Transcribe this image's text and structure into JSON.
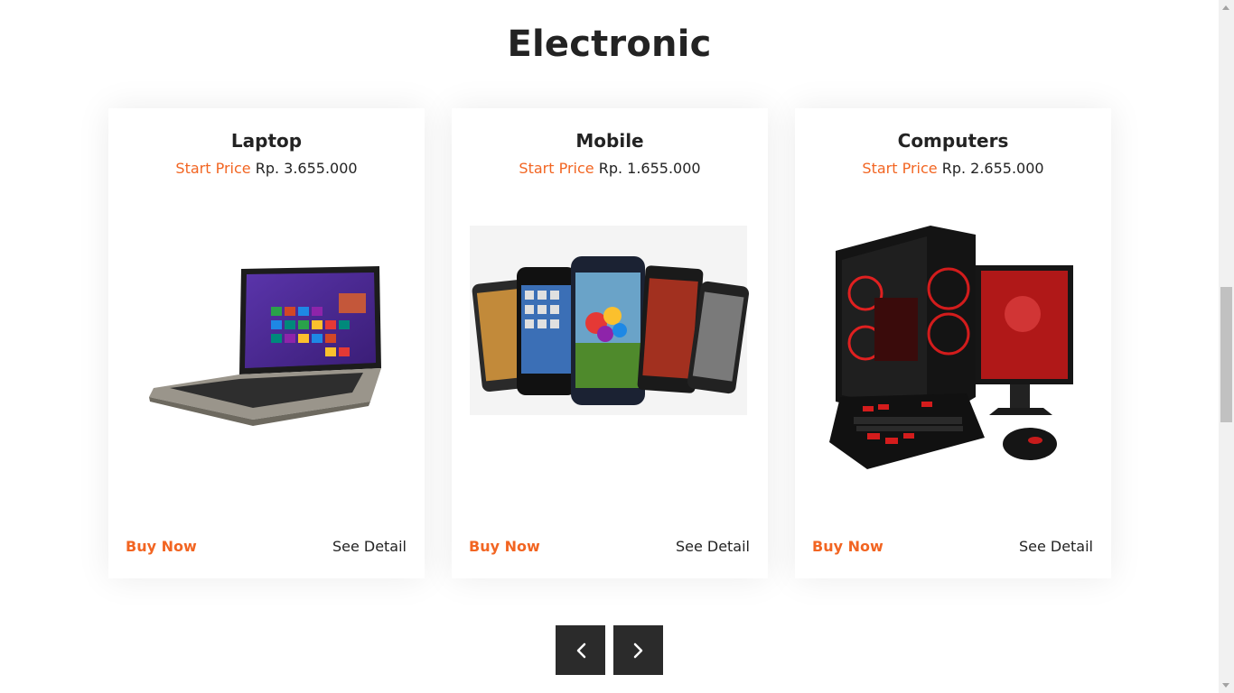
{
  "section": {
    "title": "Electronic"
  },
  "price_label": "Start Price",
  "products": [
    {
      "name": "Laptop",
      "price": "Rp. 3.655.000",
      "buy_label": "Buy Now",
      "detail_label": "See Detail",
      "image": "laptop-image"
    },
    {
      "name": "Mobile",
      "price": "Rp. 1.655.000",
      "buy_label": "Buy Now",
      "detail_label": "See Detail",
      "image": "smartphones-image"
    },
    {
      "name": "Computers",
      "price": "Rp. 2.655.000",
      "buy_label": "Buy Now",
      "detail_label": "See Detail",
      "image": "gaming-pc-image"
    }
  ],
  "carousel": {
    "prev_icon": "chevron-left-icon",
    "next_icon": "chevron-right-icon"
  },
  "colors": {
    "accent": "#f26522",
    "text": "#232323",
    "nav_button": "#2b2b2b"
  }
}
